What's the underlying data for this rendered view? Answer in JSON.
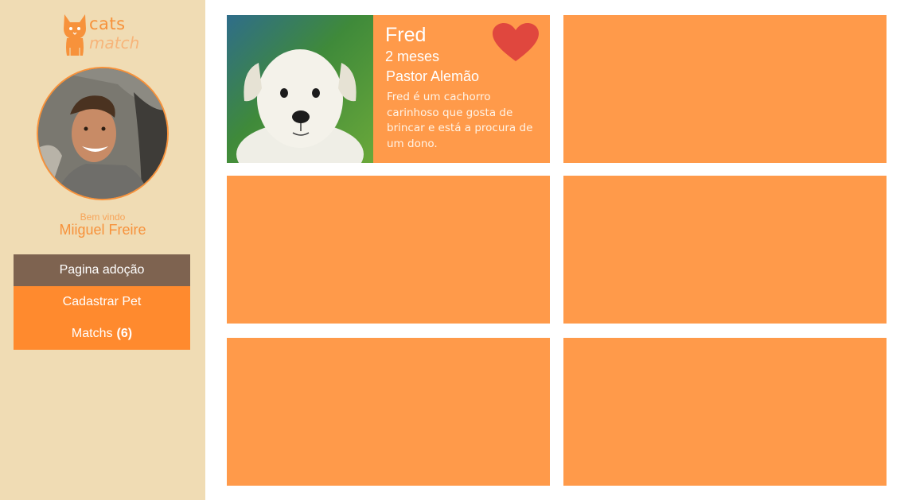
{
  "logo": {
    "line1": "cats",
    "line2": "match"
  },
  "user": {
    "welcome": "Bem vindo",
    "name": "Miiguel Freire"
  },
  "menu": {
    "adoption": "Pagina adoção",
    "register": "Cadastrar Pet",
    "matches": "Matchs",
    "matches_count": "(6)"
  },
  "pet": {
    "name": "Fred",
    "age": "2 meses",
    "breed": "Pastor Alemão",
    "description": "Fred é um cachorro carinhoso que gosta de brincar e está a procura de um dono."
  },
  "icons": {
    "logo": "cat-icon",
    "favorite": "heart-icon"
  },
  "colors": {
    "sidebar": "#f0dcb4",
    "accent": "#ff8a2e",
    "card": "#ff9a4a",
    "active": "#7e6350",
    "heart": "#e0473e"
  }
}
